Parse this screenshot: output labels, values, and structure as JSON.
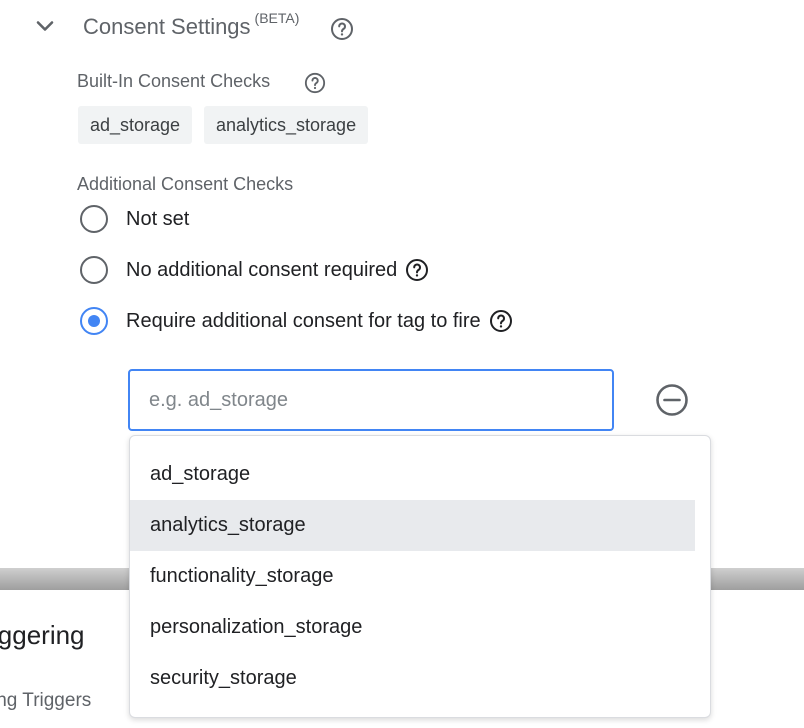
{
  "section": {
    "title": "Consent Settings",
    "beta_badge": "(BETA)"
  },
  "builtin": {
    "label": "Built-In Consent Checks",
    "chips": [
      "ad_storage",
      "analytics_storage"
    ]
  },
  "additional": {
    "label": "Additional Consent Checks",
    "options": [
      {
        "label": "Not set",
        "selected": false
      },
      {
        "label": "No additional consent required",
        "selected": false
      },
      {
        "label": "Require additional consent for tag to fire",
        "selected": true
      }
    ]
  },
  "consent_input": {
    "value": "",
    "placeholder": "e.g. ad_storage"
  },
  "dropdown": {
    "highlighted": "analytics_storage",
    "options": [
      "ad_storage",
      "analytics_storage",
      "functionality_storage",
      "personalization_storage",
      "security_storage"
    ]
  },
  "background": {
    "triggering_title": "iggering",
    "triggering_subtitle": "ing Triggers"
  },
  "colors": {
    "accent": "#4285f4",
    "muted_text": "#5f6368",
    "chip_bg": "#f1f3f4",
    "highlight_bg": "#e8eaed"
  },
  "icons": {
    "collapse": "chevron-down-icon",
    "help": "help-circle-icon",
    "remove": "remove-circle-icon"
  }
}
